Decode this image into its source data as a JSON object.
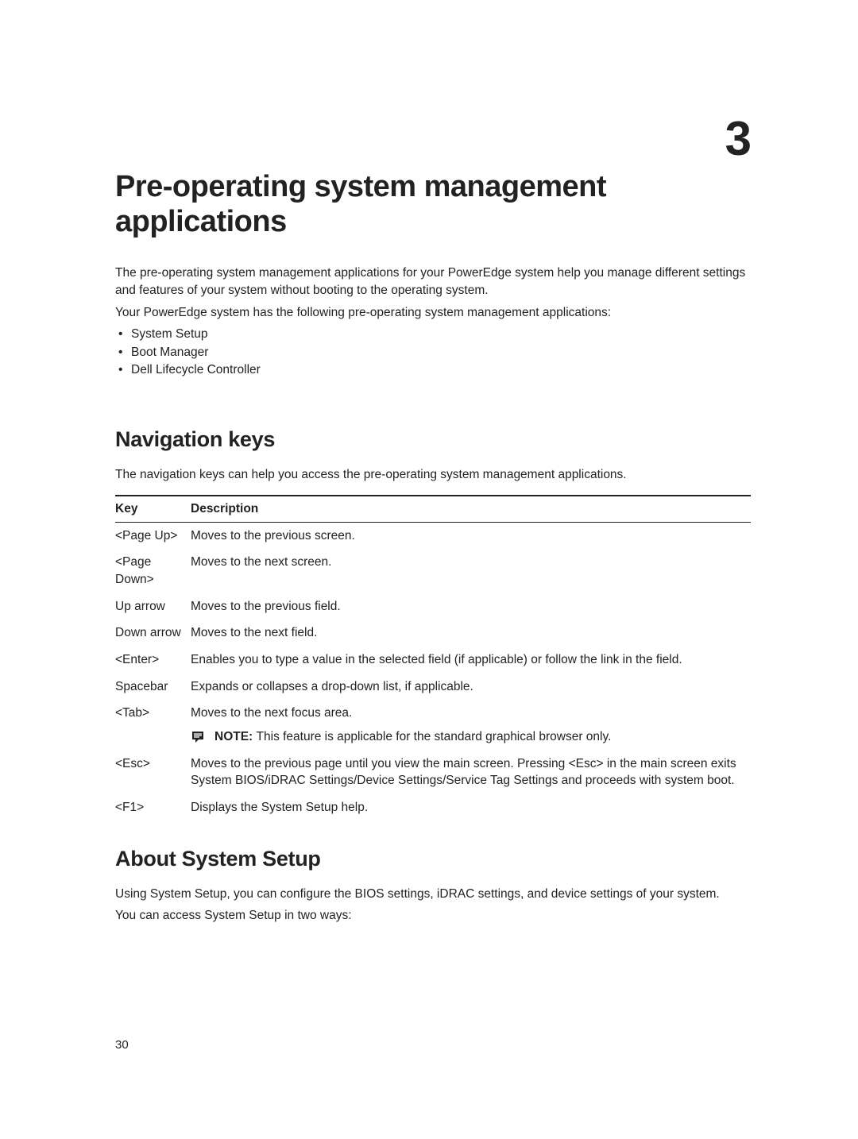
{
  "chapter": {
    "number": "3",
    "title": "Pre-operating system management applications"
  },
  "intro": {
    "p1": "The pre-operating system management applications for your PowerEdge system help you manage different settings and features of your system without booting to the operating system.",
    "p2": "Your PowerEdge system has the following pre-operating system management applications:",
    "items": {
      "0": "System Setup",
      "1": "Boot Manager",
      "2": "Dell Lifecycle Controller"
    }
  },
  "navkeys": {
    "heading": "Navigation keys",
    "lead": "The navigation keys can help you access the pre-operating system management applications.",
    "table": {
      "header": {
        "key": "Key",
        "desc": "Description"
      },
      "rows": {
        "0": {
          "key": "<Page Up>",
          "desc": "Moves to the previous screen."
        },
        "1": {
          "key": "<Page Down>",
          "desc": "Moves to the next screen."
        },
        "2": {
          "key": "Up arrow",
          "desc": "Moves to the previous field."
        },
        "3": {
          "key": "Down arrow",
          "desc": "Moves to the next field."
        },
        "4": {
          "key": "<Enter>",
          "desc": "Enables you to type a value in the selected field (if applicable) or follow the link in the field."
        },
        "5": {
          "key": "Spacebar",
          "desc": "Expands or collapses a drop-down list, if applicable."
        },
        "6": {
          "key": "<Tab>",
          "desc": "Moves to the next focus area.",
          "note_label": "NOTE: ",
          "note_text": "This feature is applicable for the standard graphical browser only."
        },
        "7": {
          "key": "<Esc>",
          "desc": "Moves to the previous page until you view the main screen. Pressing <Esc> in the main screen exits System BIOS/iDRAC Settings/Device Settings/Service Tag Settings and proceeds with system boot."
        },
        "8": {
          "key": "<F1>",
          "desc": "Displays the System Setup help."
        }
      }
    }
  },
  "about": {
    "heading": "About System Setup",
    "p1": "Using System Setup, you can configure the BIOS settings, iDRAC settings, and device settings of your system.",
    "p2": "You can access System Setup in two ways:"
  },
  "page_number": "30"
}
